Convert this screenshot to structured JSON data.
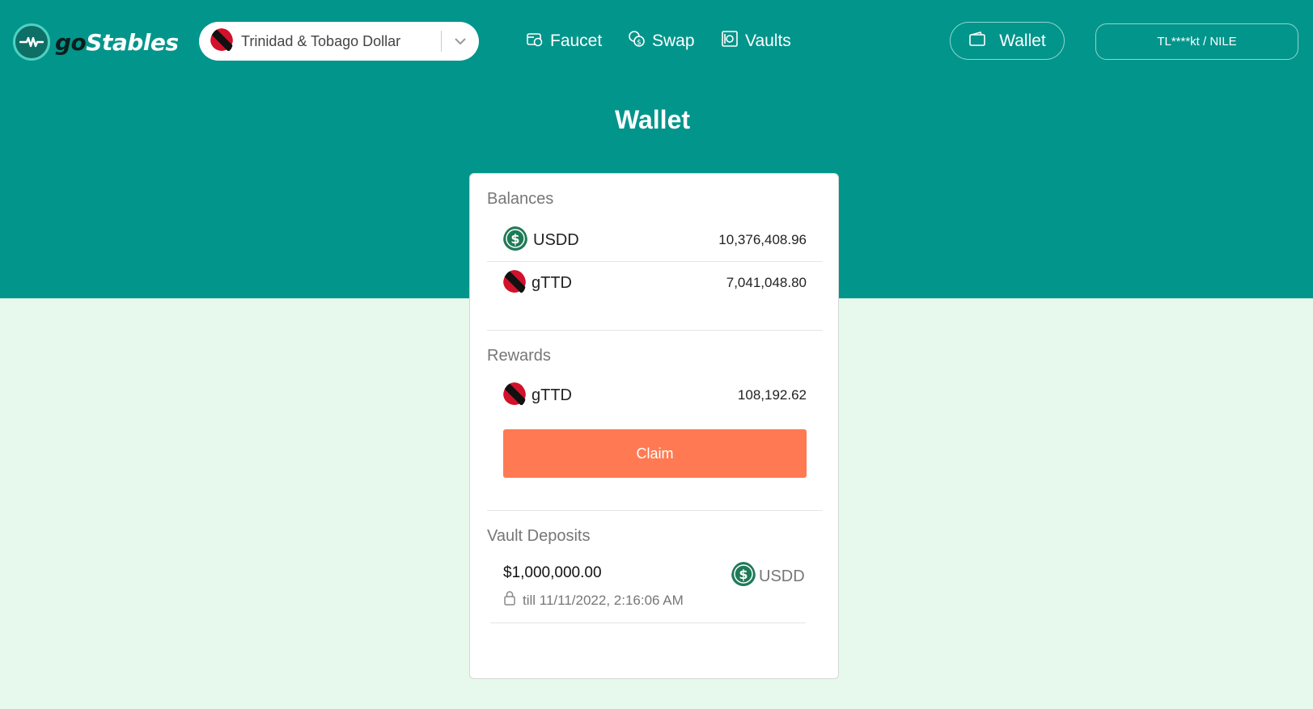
{
  "header": {
    "logo_go": "go",
    "logo_stables": "Stables",
    "currency": {
      "label": "Trinidad & Tobago Dollar"
    },
    "nav": {
      "faucet": "Faucet",
      "swap": "Swap",
      "vaults": "Vaults"
    },
    "wallet_button": "Wallet",
    "account_button": "TL****kt / NILE"
  },
  "page_title": "Wallet",
  "card": {
    "balances": {
      "title": "Balances",
      "items": [
        {
          "token": "USDD",
          "amount": "10,376,408.96",
          "icon": "usdd-coin-icon"
        },
        {
          "token": "gTTD",
          "amount": "7,041,048.80",
          "icon": "tt-flag-icon"
        }
      ]
    },
    "rewards": {
      "title": "Rewards",
      "items": [
        {
          "token": "gTTD",
          "amount": "108,192.62",
          "icon": "tt-flag-icon"
        }
      ],
      "claim_label": "Claim"
    },
    "vault_deposits": {
      "title": "Vault Deposits",
      "amount": "$1,000,000.00",
      "token": "USDD",
      "lock_text": "till 11/11/2022, 2:16:06 AM"
    }
  },
  "colors": {
    "hero_bg": "#02958b",
    "page_bg": "#e6f9ec",
    "claim_bg": "#ff7a52",
    "usdd_green": "#1f7a57",
    "tt_red": "#d2112b"
  }
}
